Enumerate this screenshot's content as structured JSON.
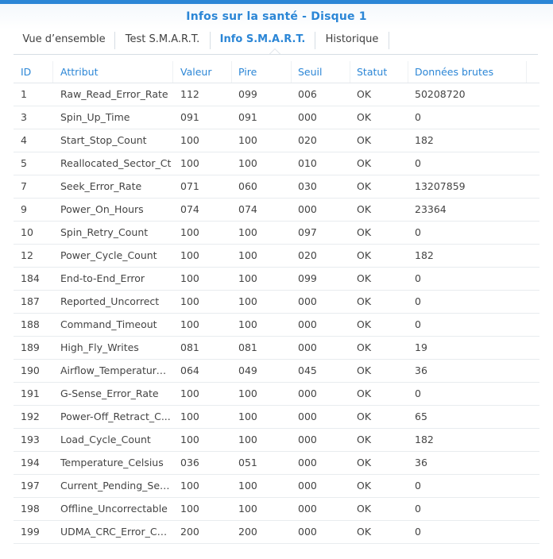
{
  "window": {
    "title": "Infos sur la santé - Disque 1"
  },
  "tabs": [
    {
      "label": "Vue d’ensemble"
    },
    {
      "label": "Test S.M.A.R.T."
    },
    {
      "label": "Info S.M.A.R.T."
    },
    {
      "label": "Historique"
    }
  ],
  "active_tab": "Info S.M.A.R.T.",
  "colors": {
    "accent": "#2b86d6",
    "text": "#444444",
    "divider": "#e8ecef"
  },
  "table": {
    "columns": [
      "ID",
      "Attribut",
      "Valeur",
      "Pire",
      "Seuil",
      "Statut",
      "Données brutes"
    ],
    "rows": [
      [
        "1",
        "Raw_Read_Error_Rate",
        "112",
        "099",
        "006",
        "OK",
        "50208720"
      ],
      [
        "3",
        "Spin_Up_Time",
        "091",
        "091",
        "000",
        "OK",
        "0"
      ],
      [
        "4",
        "Start_Stop_Count",
        "100",
        "100",
        "020",
        "OK",
        "182"
      ],
      [
        "5",
        "Reallocated_Sector_Ct",
        "100",
        "100",
        "010",
        "OK",
        "0"
      ],
      [
        "7",
        "Seek_Error_Rate",
        "071",
        "060",
        "030",
        "OK",
        "13207859"
      ],
      [
        "9",
        "Power_On_Hours",
        "074",
        "074",
        "000",
        "OK",
        "23364"
      ],
      [
        "10",
        "Spin_Retry_Count",
        "100",
        "100",
        "097",
        "OK",
        "0"
      ],
      [
        "12",
        "Power_Cycle_Count",
        "100",
        "100",
        "020",
        "OK",
        "182"
      ],
      [
        "184",
        "End-to-End_Error",
        "100",
        "100",
        "099",
        "OK",
        "0"
      ],
      [
        "187",
        "Reported_Uncorrect",
        "100",
        "100",
        "000",
        "OK",
        "0"
      ],
      [
        "188",
        "Command_Timeout",
        "100",
        "100",
        "000",
        "OK",
        "0"
      ],
      [
        "189",
        "High_Fly_Writes",
        "081",
        "081",
        "000",
        "OK",
        "19"
      ],
      [
        "190",
        "Airflow_Temperature...",
        "064",
        "049",
        "045",
        "OK",
        "36"
      ],
      [
        "191",
        "G-Sense_Error_Rate",
        "100",
        "100",
        "000",
        "OK",
        "0"
      ],
      [
        "192",
        "Power-Off_Retract_C...",
        "100",
        "100",
        "000",
        "OK",
        "65"
      ],
      [
        "193",
        "Load_Cycle_Count",
        "100",
        "100",
        "000",
        "OK",
        "182"
      ],
      [
        "194",
        "Temperature_Celsius",
        "036",
        "051",
        "000",
        "OK",
        "36"
      ],
      [
        "197",
        "Current_Pending_Sec...",
        "100",
        "100",
        "000",
        "OK",
        "0"
      ],
      [
        "198",
        "Offline_Uncorrectable",
        "100",
        "100",
        "000",
        "OK",
        "0"
      ],
      [
        "199",
        "UDMA_CRC_Error_Co...",
        "200",
        "200",
        "000",
        "OK",
        "0"
      ]
    ]
  }
}
